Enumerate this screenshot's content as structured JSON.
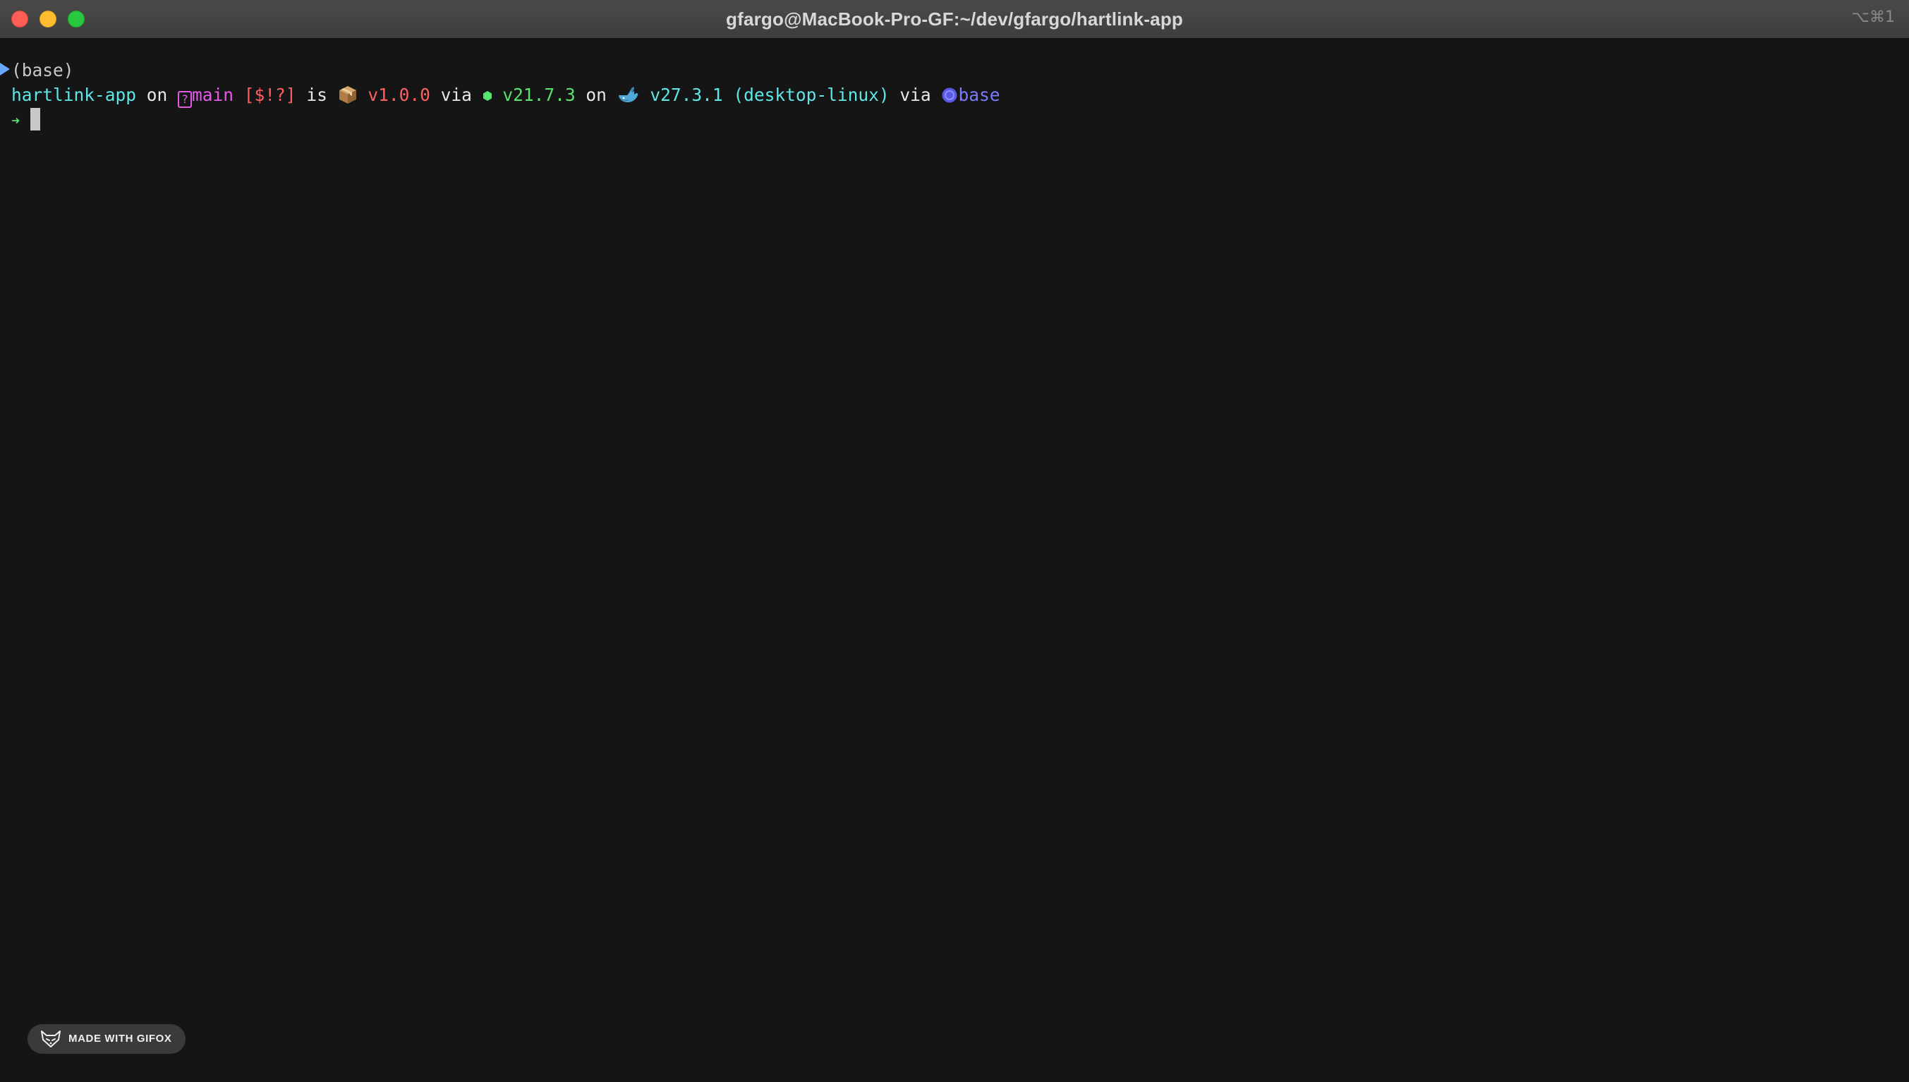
{
  "window": {
    "title": "gfargo@MacBook-Pro-GF:~/dev/gfargo/hartlink-app",
    "shortcut": "⌥⌘1",
    "traffic_lights": {
      "close": "#ff5f57",
      "minimize": "#febc2e",
      "zoom": "#28c840"
    }
  },
  "terminal": {
    "background": "#151515",
    "env_line": "(base)",
    "prompt": {
      "directory": "hartlink-app",
      "on1": " on ",
      "branch_icon": "?",
      "branch": "main",
      "git_status": " [$!?]",
      "is": " is ",
      "package_version": " v1.0.0",
      "via1": " via ",
      "node_version": " v21.7.3",
      "on2": " on ",
      "docker_version": " v27.3.1",
      "docker_context": " (desktop-linux)",
      "via2": " via ",
      "conda_env": "base"
    },
    "input_arrow": "➜",
    "input_text": ""
  },
  "icons": {
    "prompt_marker": "triangle-right-icon",
    "branch": "branch-question-icon",
    "package": "package-box-icon",
    "node": "nodejs-hexagon-icon",
    "docker": "docker-whale-icon",
    "conda": "conda-circle-icon",
    "gifox": "gifox-fox-icon"
  },
  "watermark": {
    "text": "MADE WITH GIFOX"
  }
}
